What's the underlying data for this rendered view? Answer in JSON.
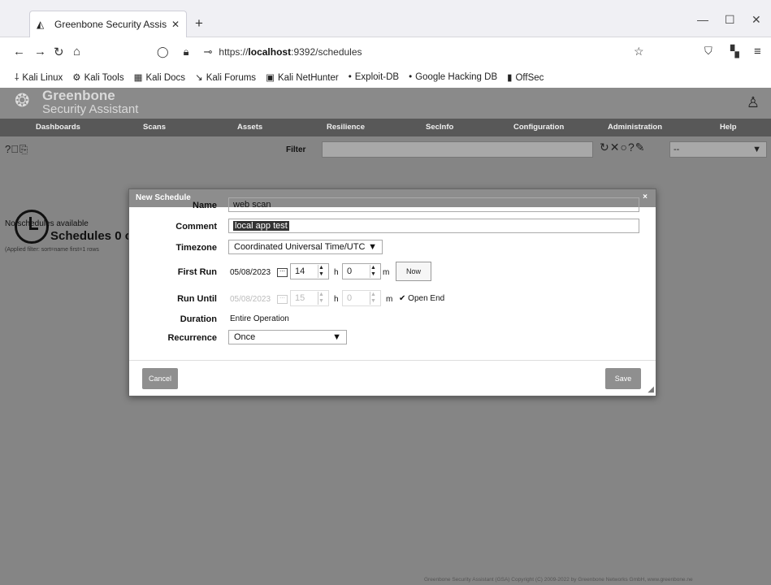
{
  "browser": {
    "tab_title": "Greenbone Security Assis",
    "new_tab": "+",
    "window_controls": [
      "—",
      "☐",
      "✕"
    ],
    "url_prefix": "https://",
    "url_host": "localhost",
    "url_rest": ":9392/schedules",
    "bookmarks": [
      {
        "icon": "kali-icon",
        "label": "Kali Linux"
      },
      {
        "icon": "kali-tools-icon",
        "label": "Kali Tools"
      },
      {
        "icon": "docs-icon",
        "label": "Kali Docs"
      },
      {
        "icon": "forums-icon",
        "label": "Kali Forums"
      },
      {
        "icon": "nethunter-icon",
        "label": "Kali NetHunter"
      },
      {
        "icon": "exploitdb-icon",
        "label": "Exploit-DB"
      },
      {
        "icon": "ghdb-icon",
        "label": "Google Hacking DB"
      },
      {
        "icon": "offsec-icon",
        "label": "OffSec"
      }
    ]
  },
  "app": {
    "logo_title": "Greenbone",
    "logo_sub": "Security Assistant",
    "nav": [
      "Dashboards",
      "Scans",
      "Assets",
      "Resilience",
      "SecInfo",
      "Configuration",
      "Administration",
      "Help"
    ],
    "filter_label": "Filter",
    "filter_select": "--",
    "page_title": "Schedules 0 o",
    "no_schedules": "No schedules available",
    "applied_filter": "(Applied filter: sort=name first=1 rows",
    "footer": "Greenbone Security Assistant (GSA) Copyright (C) 2009-2022 by Greenbone Networks GmbH, www.greenbone.ne"
  },
  "modal": {
    "title": "New Schedule",
    "close": "×",
    "labels": {
      "name": "Name",
      "comment": "Comment",
      "timezone": "Timezone",
      "first_run": "First Run",
      "run_until": "Run Until",
      "duration": "Duration",
      "recurrence": "Recurrence"
    },
    "name_value": "web scan",
    "comment_value": "local app test",
    "timezone_value": "Coordinated Universal Time/UTC",
    "first_run_date": "05/08/2023",
    "first_run_hour": "14",
    "first_run_min": "0",
    "hour_unit": "h",
    "min_unit": "m",
    "now_button": "Now",
    "run_until_date": "05/08/2023",
    "run_until_hour": "15",
    "run_until_min": "0",
    "open_end_label": "Open End",
    "open_end_checked": true,
    "duration_value": "Entire Operation",
    "recurrence_value": "Once",
    "cancel_button": "Cancel",
    "save_button": "Save"
  }
}
